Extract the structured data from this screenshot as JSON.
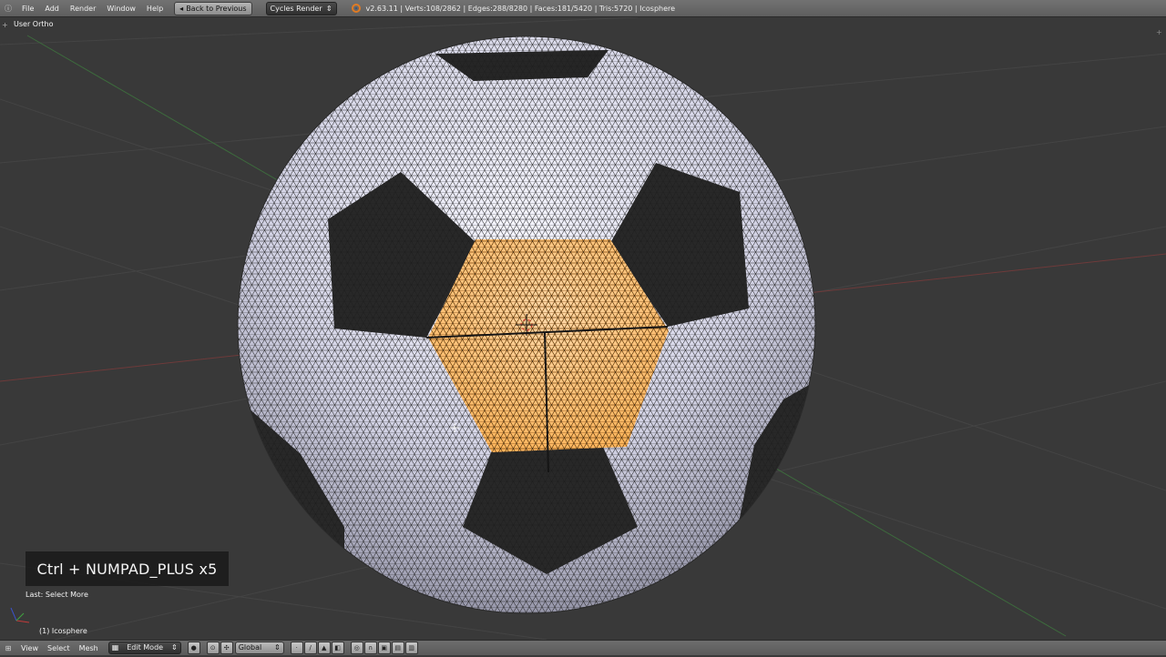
{
  "top_header": {
    "editor_icon": "info-editor-icon",
    "menus": [
      "File",
      "Add",
      "Render",
      "Window",
      "Help"
    ],
    "back_button": "Back to Previous",
    "render_engine": "Cycles Render",
    "stats": "v2.63.11 | Verts:108/2862 | Edges:288/8280 | Faces:181/5420 | Tris:5720 | Icosphere"
  },
  "viewport": {
    "view_name": "User Ortho",
    "object_label": "(1) Icosphere",
    "last_operator": "Last: Select More",
    "screencast_keys": "Ctrl + NUMPAD_PLUS x5"
  },
  "bottom_header": {
    "menus": [
      "View",
      "Select",
      "Mesh"
    ],
    "mode": "Edit Mode",
    "orientation": "Global"
  },
  "colors": {
    "viewport_bg": "#393939",
    "grid_line": "#454545",
    "x_axis": "#8a3a3a",
    "y_axis": "#3f7a3f",
    "selection": "#ffa12e",
    "mesh_wire": "#1c1c1c",
    "ball_white": "#e8e8f4",
    "ball_black": "#262626"
  }
}
